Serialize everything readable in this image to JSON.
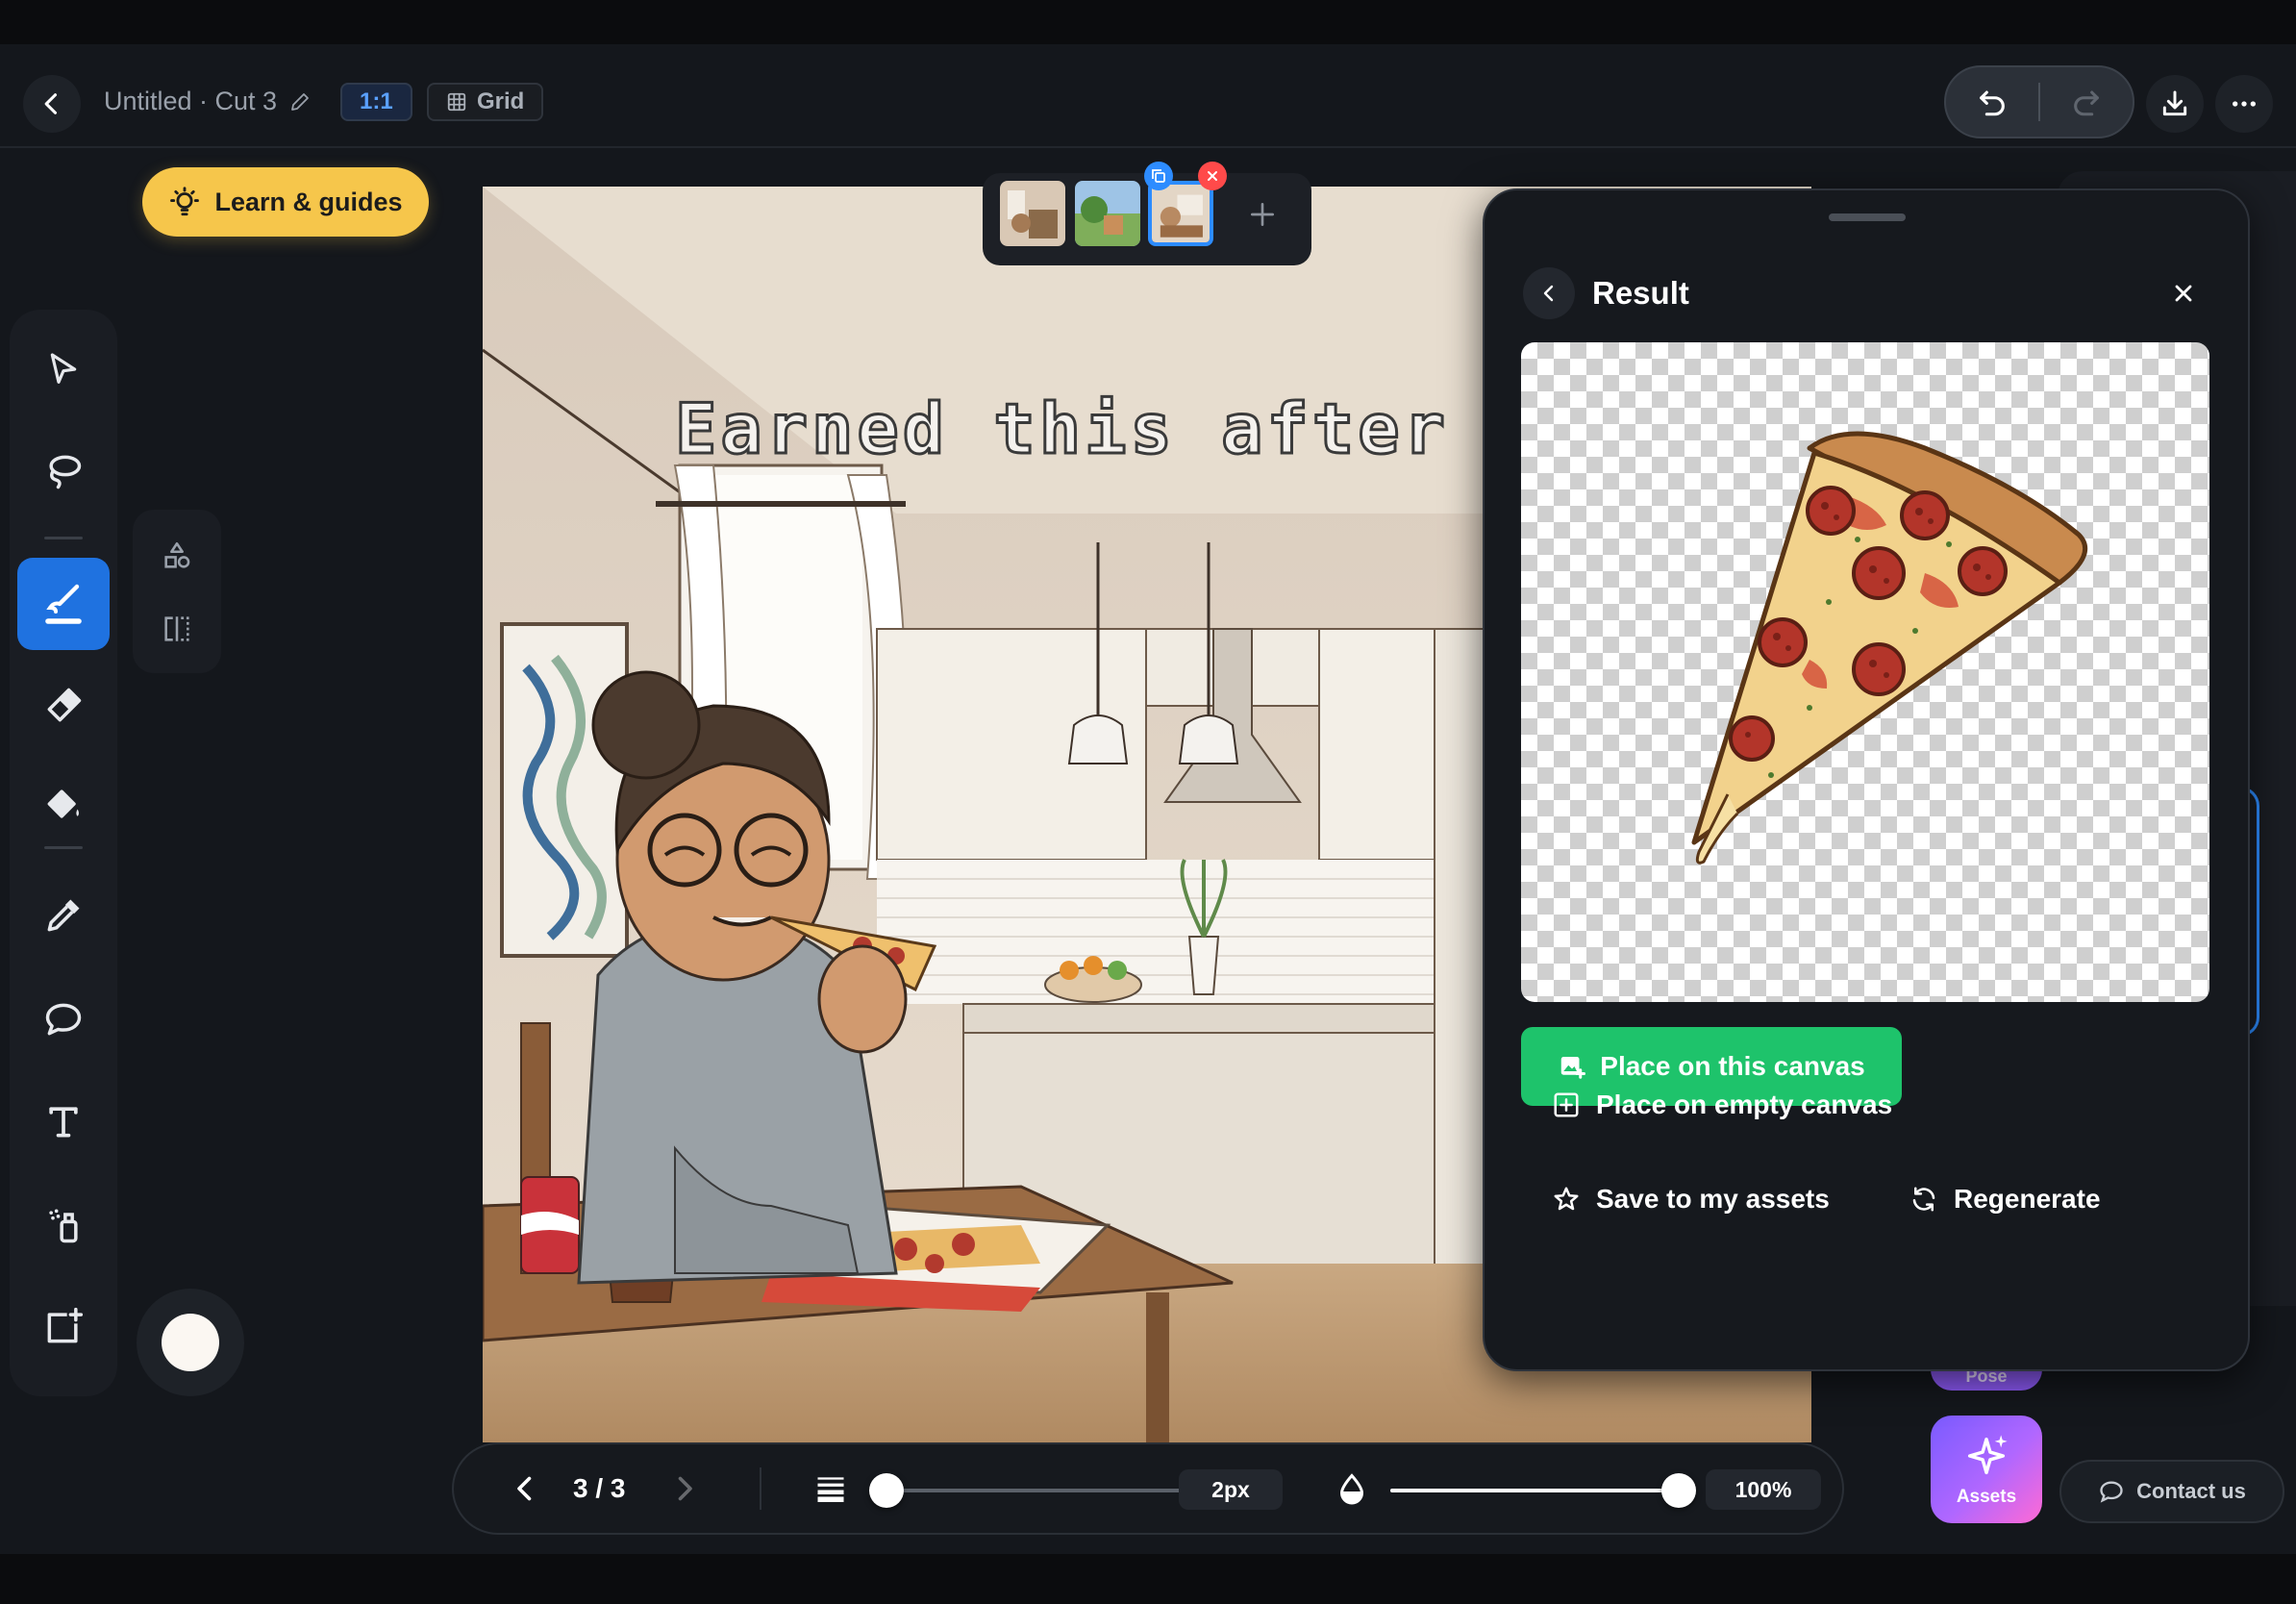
{
  "header": {
    "doc_title": "Untitled · Cut 3",
    "ratio_label": "1:1",
    "grid_label": "Grid"
  },
  "learn": {
    "label": "Learn & guides"
  },
  "canvas": {
    "caption_text": "Earned this after my w"
  },
  "bottom_bar": {
    "page_text": "3 / 3",
    "stroke_size": "2px",
    "stroke_level": 0.05,
    "opacity_value": "100%",
    "opacity_level": 1.0
  },
  "result_panel": {
    "title": "Result",
    "place_on_canvas": "Place on this canvas",
    "place_on_empty": "Place on empty canvas",
    "save_to_assets": "Save to my assets",
    "regenerate": "Regenerate"
  },
  "right_rail": {
    "pose_label": "Pose",
    "assets_label": "Assets",
    "contact_label": "Contact us"
  },
  "colors": {
    "accent_blue": "#1f72e0",
    "learn_yellow": "#f6c64b",
    "place_green": "#1ec36b",
    "delete_red": "#ff4a4a",
    "current_color": "#fbf7f2"
  }
}
